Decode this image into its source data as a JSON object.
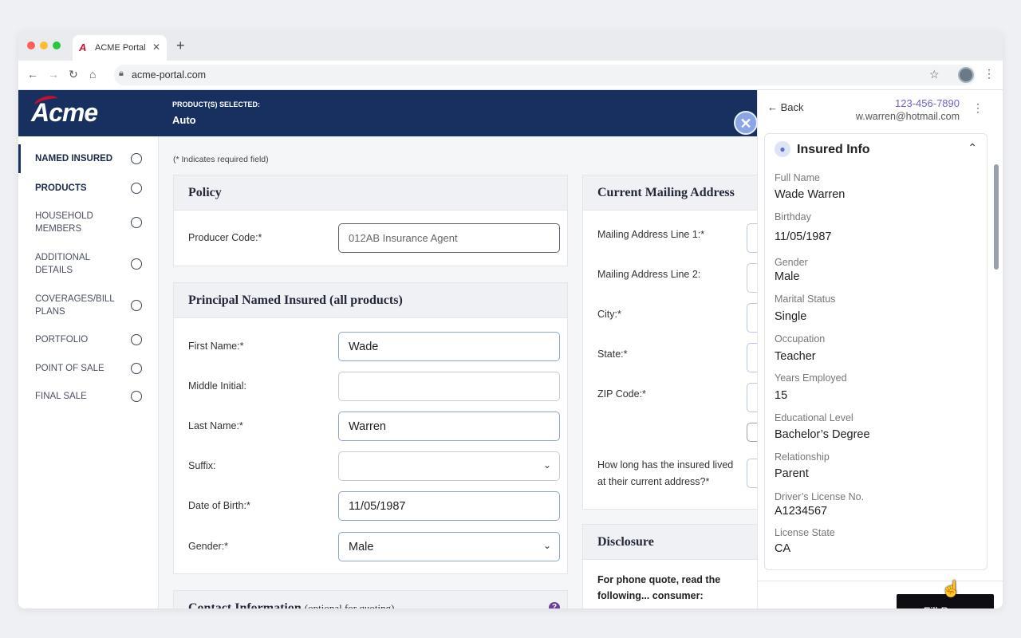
{
  "browser": {
    "tab_title": "ACME Portal",
    "url": "acme-portal.com",
    "colors": {
      "close": "#ff5f57",
      "minimize": "#febc2e",
      "maximize": "#28c840"
    }
  },
  "header": {
    "logo_text": "Acme",
    "products_label": "PRODUCT(S) SELECTED:",
    "products_value": "Auto"
  },
  "sidebar": {
    "items": [
      {
        "label": "NAMED INSURED"
      },
      {
        "label": "PRODUCTS"
      },
      {
        "label": "HOUSEHOLD MEMBERS"
      },
      {
        "label": "ADDITIONAL DETAILS"
      },
      {
        "label": "COVERAGES/BILL PLANS"
      },
      {
        "label": "PORTFOLIO"
      },
      {
        "label": "POINT OF SALE"
      },
      {
        "label": "FINAL SALE"
      }
    ]
  },
  "form": {
    "required_note": "(* Indicates required field)",
    "policy": {
      "title": "Policy",
      "producer_label": "Producer Code:*",
      "producer_value": "012AB Insurance Agent"
    },
    "principal": {
      "title": "Principal Named Insured (all products)",
      "first_name_label": "First Name:*",
      "first_name_value": "Wade",
      "middle_label": "Middle Initial:",
      "middle_value": "",
      "last_name_label": "Last Name:*",
      "last_name_value": "Warren",
      "suffix_label": "Suffix:",
      "suffix_value": "",
      "dob_label": "Date of Birth:*",
      "dob_value": "11/05/1987",
      "gender_label": "Gender:*",
      "gender_value": "Male"
    },
    "contact": {
      "title": "Contact Information",
      "subtitle": "(optional for quoting)"
    },
    "mailing": {
      "title": "Current Mailing Address",
      "line1_label": "Mailing Address Line 1:*",
      "line2_label": "Mailing Address Line 2:",
      "city_label": "City:*",
      "state_label": "State:*",
      "zip_label": "ZIP Code:*",
      "howlong_label": "How long has the insured lived at their current address?*"
    },
    "disclosure": {
      "title": "Disclosure",
      "text": "For phone quote, read the following... consumer:"
    }
  },
  "panel": {
    "back_label": "Back",
    "phone": "123-456-7890",
    "email": "w.warren@hotmail.com",
    "card_title": "Insured Info",
    "fields": [
      {
        "label": "Full Name",
        "value": "Wade Warren"
      },
      {
        "label": "Birthday",
        "value": "11/05/1987"
      },
      {
        "label": "Gender",
        "value": "Male"
      },
      {
        "label": "Marital Status",
        "value": "Single"
      },
      {
        "label": "Occupation",
        "value": "Teacher"
      },
      {
        "label": "Years Employed",
        "value": "15"
      },
      {
        "label": "Educational Level",
        "value": "Bachelor’s Degree"
      },
      {
        "label": "Relationship",
        "value": "Parent"
      },
      {
        "label": "Driver’s License No.",
        "value": "A1234567"
      },
      {
        "label": "License State",
        "value": "CA"
      }
    ],
    "fill_button": "Fill Page"
  },
  "icons": {
    "back": "arrow-left-icon",
    "forward": "arrow-right-icon",
    "reload": "reload-icon",
    "home": "home-icon",
    "lock": "lock-icon",
    "bookmark": "star-icon",
    "menu": "kebab-icon",
    "close_sidebar": "close-icon",
    "user": "user-icon",
    "collapse": "chevron-up-icon",
    "dropdown": "chevron-down-icon",
    "help": "help-icon"
  }
}
